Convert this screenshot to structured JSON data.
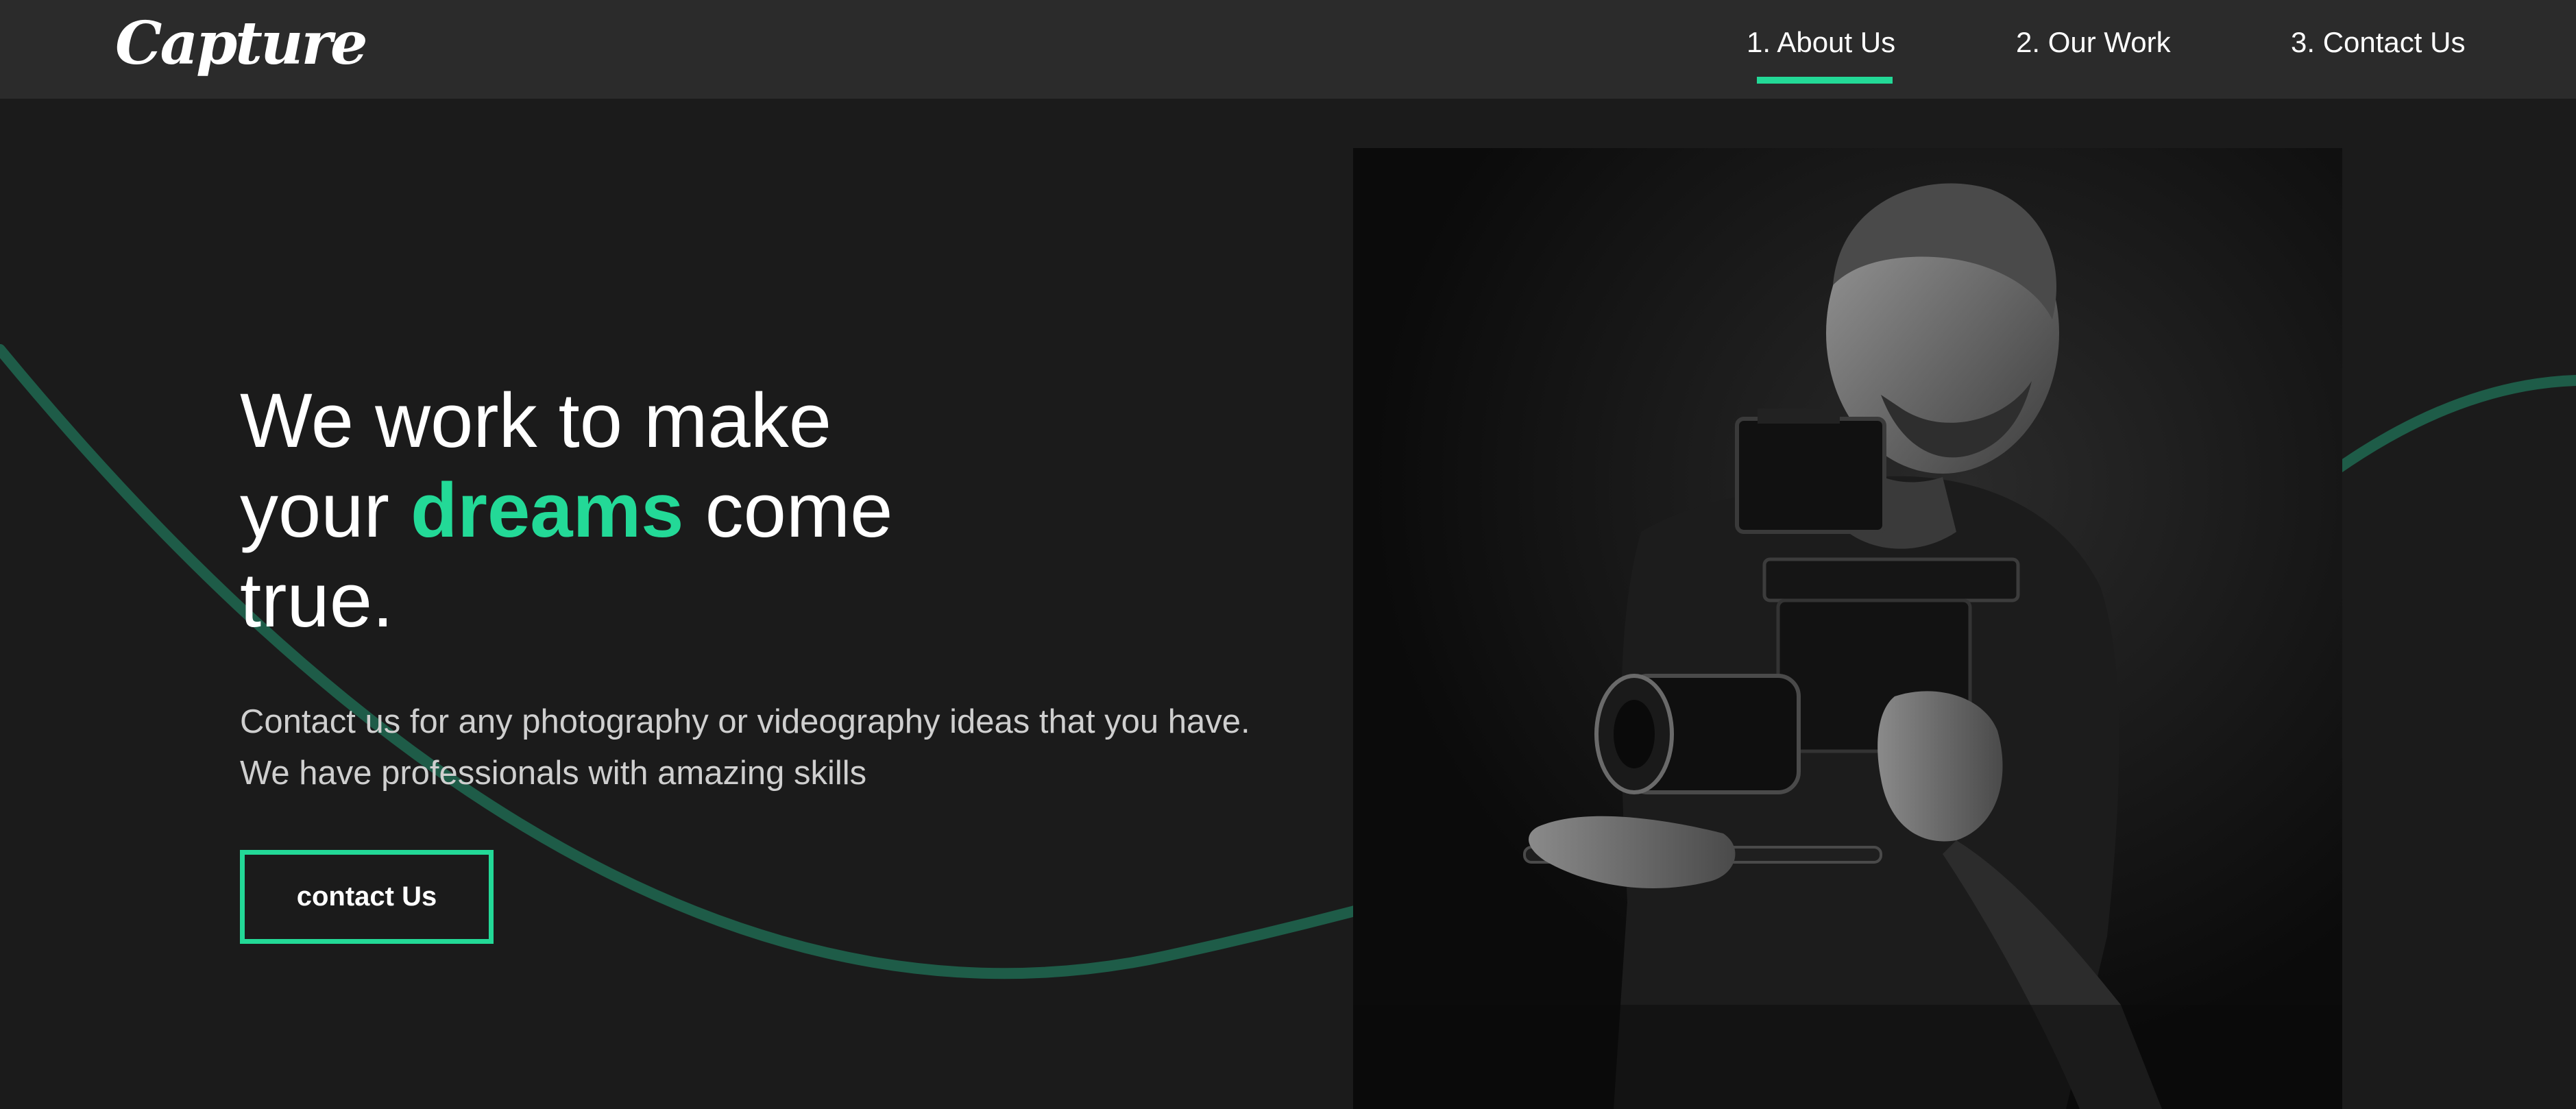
{
  "brand": {
    "logo_text": "Capture",
    "accent_color": "#23d997"
  },
  "nav": {
    "items": [
      {
        "label": "1. About Us",
        "active": true
      },
      {
        "label": "2. Our Work",
        "active": false
      },
      {
        "label": "3. Contact Us",
        "active": false
      }
    ]
  },
  "hero": {
    "title": {
      "line1": "We work to make",
      "line2_before": "your ",
      "line2_highlight": "dreams",
      "line2_after": " come",
      "line3": "true."
    },
    "description": "Contact us for any photography or videography ideas that you have. We have professionals with amazing skills",
    "cta_label": "contact Us",
    "image": {
      "subject": "man-operating-cinema-camera-rig",
      "style": "black-and-white"
    }
  },
  "colors": {
    "background": "#1b1b1b",
    "header": "#2b2b2b",
    "accent": "#23d997",
    "wave": "#1e5c48"
  }
}
